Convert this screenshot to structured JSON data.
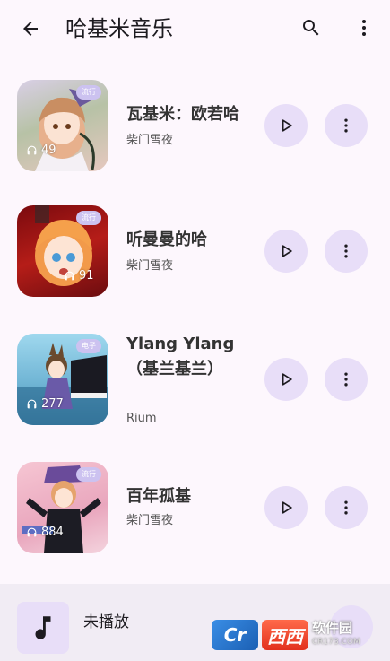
{
  "appbar": {
    "title": "哈基米音乐",
    "back_icon": "arrow-left-icon",
    "search_icon": "search-icon",
    "more_icon": "more-vert-icon"
  },
  "songs": [
    {
      "title": "瓦基米：欧若哈",
      "artist": "柴门雪夜",
      "genre": "流行",
      "plays": "49",
      "cover_colors": [
        "#c9c1d9",
        "#7a8a6b",
        "#e9cfc4"
      ]
    },
    {
      "title": "听曼曼的哈",
      "artist": "柴门雪夜",
      "genre": "流行",
      "plays": "91",
      "cover_colors": [
        "#8b0f12",
        "#c4311a",
        "#f5b27c"
      ]
    },
    {
      "title": "Ylang Ylang（基兰基兰）",
      "artist": "Rium",
      "genre": "电子",
      "plays": "277",
      "cover_colors": [
        "#8fd0e8",
        "#3a6f93",
        "#e6f4f8"
      ]
    },
    {
      "title": "百年孤基",
      "artist": "柴门雪夜",
      "genre": "流行",
      "plays": "884",
      "cover_colors": [
        "#f1b9c9",
        "#1b1b24",
        "#d97aa0"
      ]
    }
  ],
  "mini_player": {
    "title": "未播放",
    "icon": "music-note-icon"
  },
  "watermark": {
    "logo": "Cr",
    "name": "西西",
    "sub": "软件园",
    "site": "CR173.COM"
  },
  "colors": {
    "background": "#fdf7fd",
    "button_tint": "#e8def8",
    "icon": "#1d1b20",
    "accent": "#6750a4"
  }
}
